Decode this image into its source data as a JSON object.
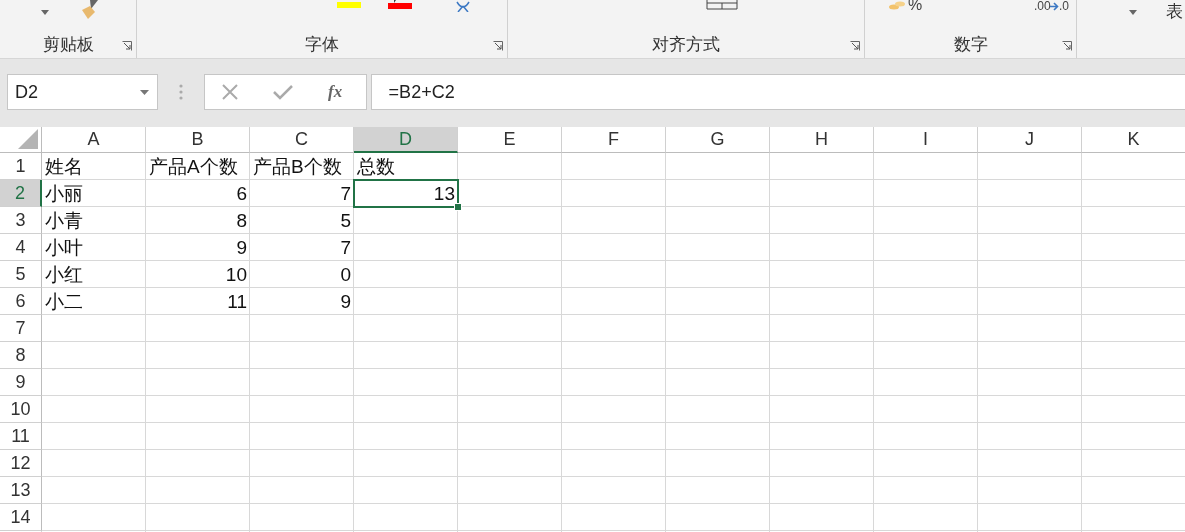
{
  "ribbon": {
    "groups": [
      {
        "label": "剪贴板",
        "launcher": true
      },
      {
        "label": "字体",
        "launcher": true
      },
      {
        "label": "对齐方式",
        "launcher": true
      },
      {
        "label": "数字",
        "launcher": true,
        "texts": [
          "%",
          ".00",
          ".0"
        ]
      }
    ],
    "overflow_text": "表"
  },
  "formula_bar": {
    "name_box": "D2",
    "function_label": "fx",
    "formula": "=B2+C2"
  },
  "sheet": {
    "columns": [
      {
        "label": "A",
        "selected": false
      },
      {
        "label": "B",
        "selected": false
      },
      {
        "label": "C",
        "selected": false
      },
      {
        "label": "D",
        "selected": true
      },
      {
        "label": "E",
        "selected": false
      },
      {
        "label": "F",
        "selected": false
      },
      {
        "label": "G",
        "selected": false
      },
      {
        "label": "H",
        "selected": false
      },
      {
        "label": "I",
        "selected": false
      },
      {
        "label": "J",
        "selected": false
      },
      {
        "label": "K",
        "selected": false
      }
    ],
    "rows": [
      {
        "number": "1",
        "selected": false,
        "cells": [
          {
            "text": "姓名",
            "kind": "text"
          },
          {
            "text": "产品A个数",
            "kind": "text"
          },
          {
            "text": "产品B个数",
            "kind": "text"
          },
          {
            "text": "总数",
            "kind": "text"
          }
        ]
      },
      {
        "number": "2",
        "selected": true,
        "cells": [
          {
            "text": "小丽",
            "kind": "text"
          },
          {
            "text": "6",
            "kind": "number"
          },
          {
            "text": "7",
            "kind": "number"
          },
          {
            "text": "13",
            "kind": "number",
            "selected": true
          }
        ]
      },
      {
        "number": "3",
        "selected": false,
        "cells": [
          {
            "text": "小青",
            "kind": "text"
          },
          {
            "text": "8",
            "kind": "number"
          },
          {
            "text": "5",
            "kind": "number"
          }
        ]
      },
      {
        "number": "4",
        "selected": false,
        "cells": [
          {
            "text": "小叶",
            "kind": "text"
          },
          {
            "text": "9",
            "kind": "number"
          },
          {
            "text": "7",
            "kind": "number"
          }
        ]
      },
      {
        "number": "5",
        "selected": false,
        "cells": [
          {
            "text": "小红",
            "kind": "text"
          },
          {
            "text": "10",
            "kind": "number"
          },
          {
            "text": "0",
            "kind": "number"
          }
        ]
      },
      {
        "number": "6",
        "selected": false,
        "cells": [
          {
            "text": "小二",
            "kind": "text"
          },
          {
            "text": "11",
            "kind": "number"
          },
          {
            "text": "9",
            "kind": "number"
          }
        ]
      },
      {
        "number": "7",
        "selected": false,
        "cells": []
      },
      {
        "number": "8",
        "selected": false,
        "cells": []
      },
      {
        "number": "9",
        "selected": false,
        "cells": []
      },
      {
        "number": "10",
        "selected": false,
        "cells": []
      },
      {
        "number": "11",
        "selected": false,
        "cells": []
      },
      {
        "number": "12",
        "selected": false,
        "cells": []
      },
      {
        "number": "13",
        "selected": false,
        "cells": []
      },
      {
        "number": "14",
        "selected": false,
        "cells": []
      }
    ]
  }
}
